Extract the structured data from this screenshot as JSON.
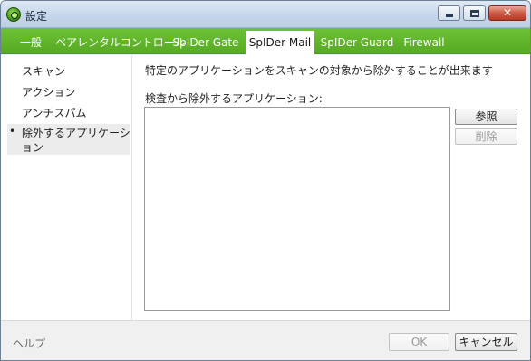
{
  "window": {
    "title": "設定",
    "icon": "drweb-spider-icon",
    "controls": {
      "minimize": "minimize-icon",
      "maximize": "maximize-icon",
      "close": "✕"
    }
  },
  "tabs": [
    {
      "label": "一般",
      "active": false
    },
    {
      "label": "ペアレンタルコントロール",
      "active": false
    },
    {
      "label": "SpIDer Gate",
      "active": false
    },
    {
      "label": "SpIDer Mail",
      "active": true
    },
    {
      "label": "SpIDer Guard",
      "active": false
    },
    {
      "label": "Firewall",
      "active": false
    }
  ],
  "sidebar": {
    "items": [
      {
        "label": "スキャン",
        "selected": false
      },
      {
        "label": "アクション",
        "selected": false
      },
      {
        "label": "アンチスパム",
        "selected": false
      },
      {
        "label": "除外するアプリケーション",
        "selected": true,
        "bullet": "•"
      }
    ]
  },
  "main": {
    "description": "特定のアプリケーションをスキャンの対象から除外することが出来ます",
    "list_label": "検査から除外するアプリケーション:",
    "list_items": [],
    "browse_button": "参照",
    "delete_button": "削除"
  },
  "footer": {
    "help": "ヘルプ",
    "ok_button": "OK",
    "cancel_button": "キャンセル"
  },
  "colors": {
    "tab_bar": "#5cb126",
    "titlebar": "#c6d6ea",
    "selected_item": "#ececec"
  }
}
